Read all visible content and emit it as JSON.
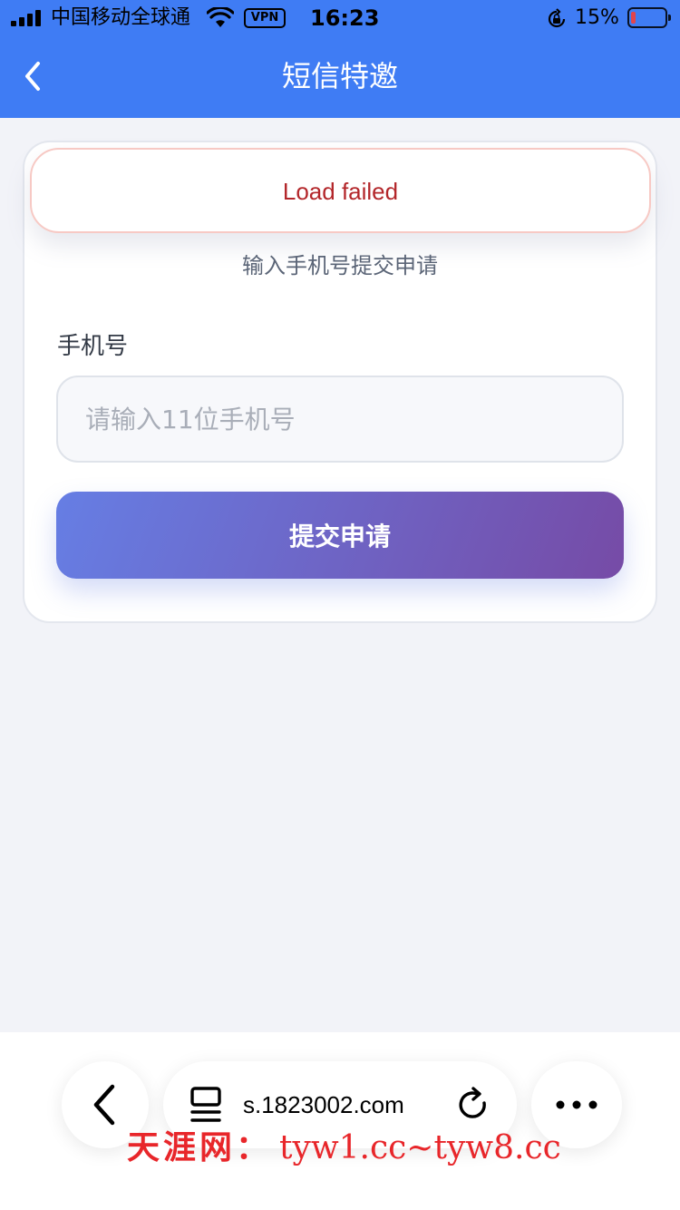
{
  "status_bar": {
    "carrier": "中国移动全球通",
    "vpn": "VPN",
    "time": "16:23",
    "battery_pct": "15%",
    "battery_level": 0.15,
    "battery_color": "#ff3b30"
  },
  "nav": {
    "title": "短信特邀",
    "back_icon": "chevron-left-icon"
  },
  "toast": {
    "text": "Load failed"
  },
  "form": {
    "subtitle": "输入手机号提交申请",
    "phone_label": "手机号",
    "phone_value": "",
    "phone_placeholder": "请输入11位手机号",
    "submit_label": "提交申请"
  },
  "browser_toolbar": {
    "url": "s.1823002.com",
    "icons": [
      "chevron-left-icon",
      "tabs-icon",
      "reload-icon",
      "more-icon"
    ]
  },
  "watermark": {
    "cn": "天涯网：",
    "url": "tyw1.cc~tyw8.cc"
  },
  "colors": {
    "primary": "#3f7cf4",
    "error": "#b3262a",
    "button_gradient_start": "#667ee4",
    "button_gradient_end": "#764ba6"
  }
}
